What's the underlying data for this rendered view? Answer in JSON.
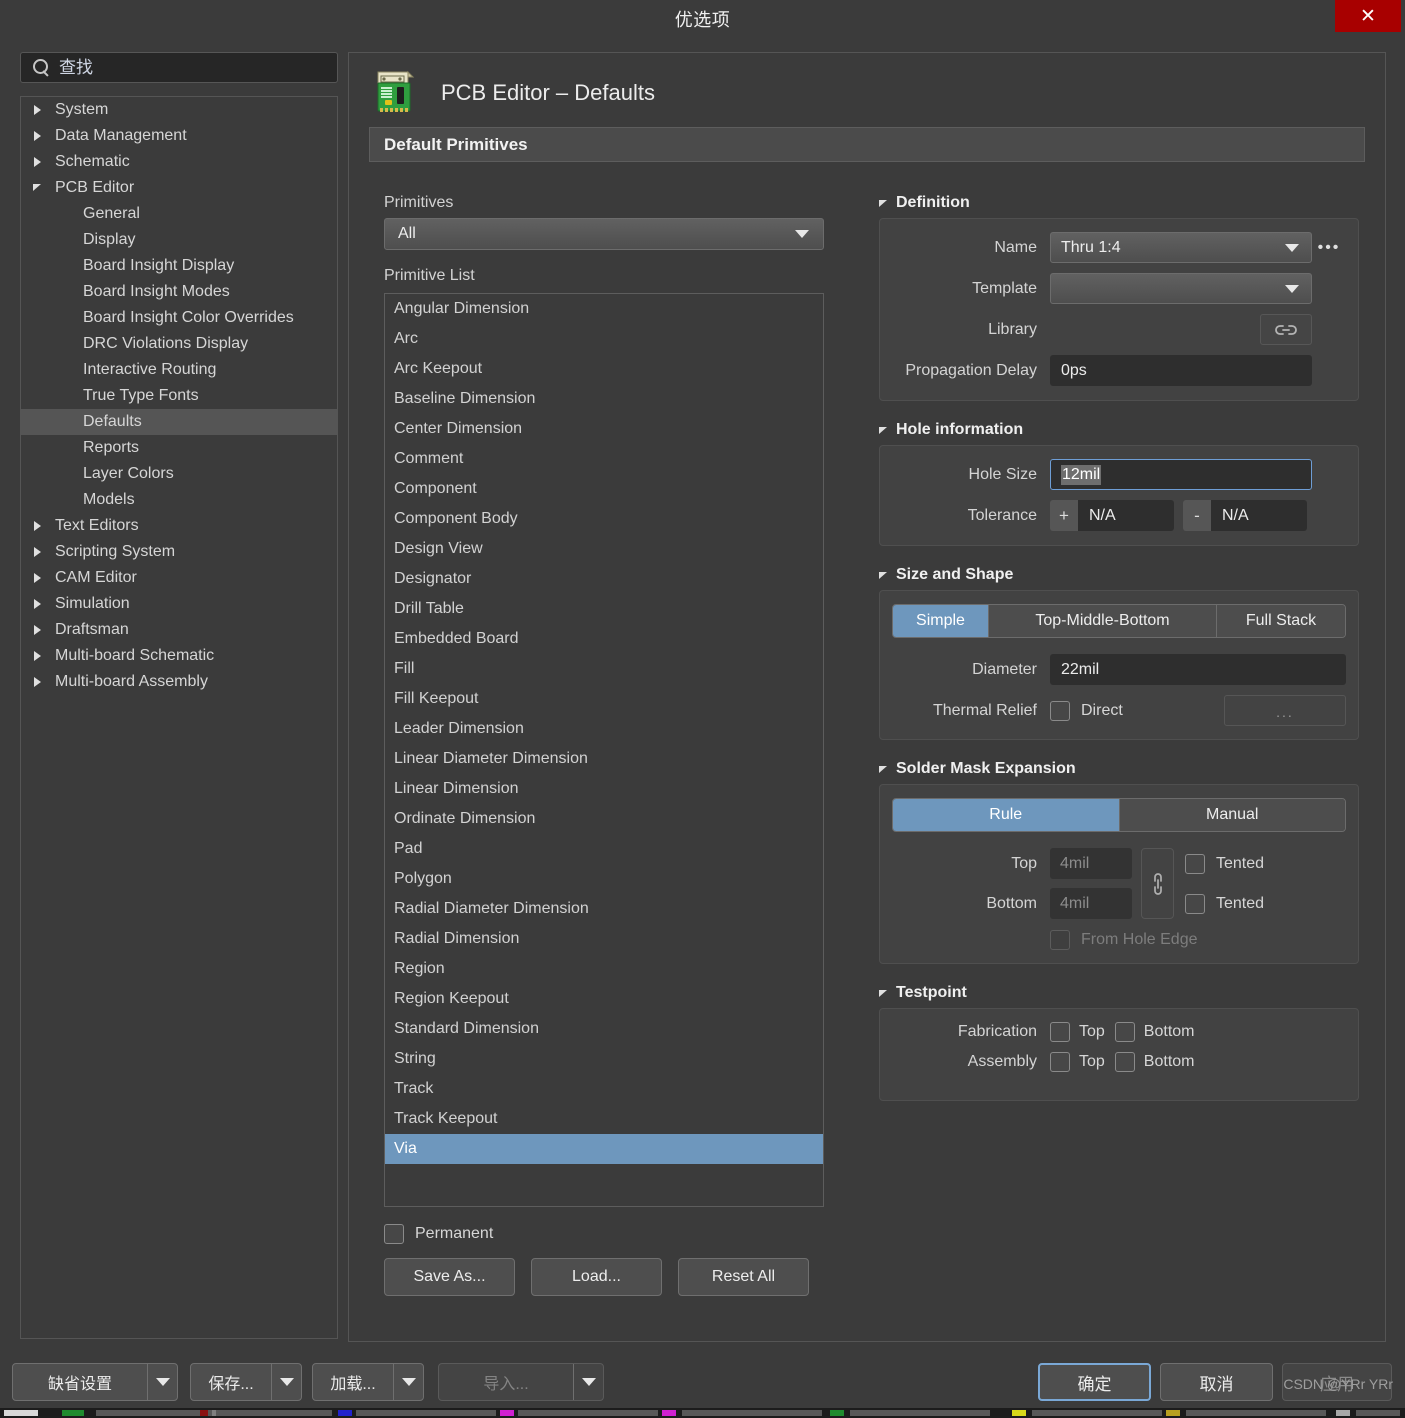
{
  "window": {
    "title": "优选项",
    "close_label": "✕"
  },
  "search": {
    "placeholder": "查找",
    "icon": "search-icon"
  },
  "sidebar": {
    "items": [
      {
        "label": "System",
        "level": 0,
        "state": "collapsed",
        "selected": false
      },
      {
        "label": "Data Management",
        "level": 0,
        "state": "collapsed",
        "selected": false
      },
      {
        "label": "Schematic",
        "level": 0,
        "state": "collapsed",
        "selected": false
      },
      {
        "label": "PCB Editor",
        "level": 0,
        "state": "expanded",
        "selected": false
      },
      {
        "label": "General",
        "level": 1,
        "state": "none",
        "selected": false
      },
      {
        "label": "Display",
        "level": 1,
        "state": "none",
        "selected": false
      },
      {
        "label": "Board Insight Display",
        "level": 1,
        "state": "none",
        "selected": false
      },
      {
        "label": "Board Insight Modes",
        "level": 1,
        "state": "none",
        "selected": false
      },
      {
        "label": "Board Insight Color Overrides",
        "level": 1,
        "state": "none",
        "selected": false
      },
      {
        "label": "DRC Violations Display",
        "level": 1,
        "state": "none",
        "selected": false
      },
      {
        "label": "Interactive Routing",
        "level": 1,
        "state": "none",
        "selected": false
      },
      {
        "label": "True Type Fonts",
        "level": 1,
        "state": "none",
        "selected": false
      },
      {
        "label": "Defaults",
        "level": 1,
        "state": "none",
        "selected": true
      },
      {
        "label": "Reports",
        "level": 1,
        "state": "none",
        "selected": false
      },
      {
        "label": "Layer Colors",
        "level": 1,
        "state": "none",
        "selected": false
      },
      {
        "label": "Models",
        "level": 1,
        "state": "none",
        "selected": false
      },
      {
        "label": "Text Editors",
        "level": 0,
        "state": "collapsed",
        "selected": false
      },
      {
        "label": "Scripting System",
        "level": 0,
        "state": "collapsed",
        "selected": false
      },
      {
        "label": "CAM Editor",
        "level": 0,
        "state": "collapsed",
        "selected": false
      },
      {
        "label": "Simulation",
        "level": 0,
        "state": "collapsed",
        "selected": false
      },
      {
        "label": "Draftsman",
        "level": 0,
        "state": "collapsed",
        "selected": false
      },
      {
        "label": "Multi-board Schematic",
        "level": 0,
        "state": "collapsed",
        "selected": false
      },
      {
        "label": "Multi-board Assembly",
        "level": 0,
        "state": "collapsed",
        "selected": false
      }
    ]
  },
  "page": {
    "title": "PCB Editor – Defaults",
    "icon": "pcb-board-icon",
    "section_header": "Default Primitives"
  },
  "primitives": {
    "filter_label": "Primitives",
    "filter_value": "All",
    "list_label": "Primitive List",
    "list_items": [
      "Angular Dimension",
      "Arc",
      "Arc Keepout",
      "Baseline Dimension",
      "Center Dimension",
      "Comment",
      "Component",
      "Component Body",
      "Design View",
      "Designator",
      "Drill Table",
      "Embedded Board",
      "Fill",
      "Fill Keepout",
      "Leader Dimension",
      "Linear Diameter Dimension",
      "Linear Dimension",
      "Ordinate Dimension",
      "Pad",
      "Polygon",
      "Radial Diameter Dimension",
      "Radial Dimension",
      "Region",
      "Region Keepout",
      "Standard Dimension",
      "String",
      "Track",
      "Track Keepout",
      "Via"
    ],
    "selected_item": "Via",
    "permanent_label": "Permanent",
    "permanent_checked": false,
    "buttons": {
      "save_as": "Save As...",
      "load": "Load...",
      "reset_all": "Reset All"
    }
  },
  "definition": {
    "title": "Definition",
    "name_label": "Name",
    "name_value": "Thru 1:4",
    "name_more": "•••",
    "template_label": "Template",
    "template_value": "",
    "library_label": "Library",
    "library_value": "",
    "library_link_icon": "link-icon",
    "propagation_label": "Propagation Delay",
    "propagation_value": "0ps"
  },
  "hole_information": {
    "title": "Hole information",
    "hole_size_label": "Hole Size",
    "hole_size_value": "12mil",
    "tolerance_label": "Tolerance",
    "tolerance_plus_sign": "+",
    "tolerance_plus_value": "N/A",
    "tolerance_minus_sign": "-",
    "tolerance_minus_value": "N/A"
  },
  "size_and_shape": {
    "title": "Size and Shape",
    "modes": [
      "Simple",
      "Top-Middle-Bottom",
      "Full Stack"
    ],
    "active_mode": "Simple",
    "diameter_label": "Diameter",
    "diameter_value": "22mil",
    "thermal_relief_label": "Thermal Relief",
    "direct_label": "Direct",
    "direct_checked": false,
    "thermal_more": "..."
  },
  "solder_mask_expansion": {
    "title": "Solder Mask Expansion",
    "modes": [
      "Rule",
      "Manual"
    ],
    "active_mode": "Rule",
    "top_label": "Top",
    "top_value": "4mil",
    "bottom_label": "Bottom",
    "bottom_value": "4mil",
    "chain_icon": "chain-link-icon",
    "tented_top_label": "Tented",
    "tented_top_checked": false,
    "tented_bottom_label": "Tented",
    "tented_bottom_checked": false,
    "from_hole_edge_label": "From Hole Edge",
    "from_hole_edge_checked": false,
    "from_hole_edge_disabled": true
  },
  "testpoint": {
    "title": "Testpoint",
    "fabrication_label": "Fabrication",
    "fabrication_top_label": "Top",
    "fabrication_top_checked": false,
    "fabrication_bottom_label": "Bottom",
    "fabrication_bottom_checked": false,
    "assembly_label": "Assembly",
    "assembly_top_label": "Top",
    "assembly_top_checked": false,
    "assembly_bottom_label": "Bottom",
    "assembly_bottom_checked": false
  },
  "footer": {
    "defaults_btn": "缺省设置",
    "save_btn": "保存...",
    "load_btn": "加载...",
    "import_btn": "导入...",
    "ok_btn": "确定",
    "cancel_btn": "取消",
    "apply_btn": "应用",
    "watermark": "CSDN @YRr YRr"
  },
  "colors": {
    "accent": "#6e97bd",
    "close_red": "#a80000",
    "panel_bg": "#3b3b3b",
    "field_bg": "#2e2e2e"
  }
}
